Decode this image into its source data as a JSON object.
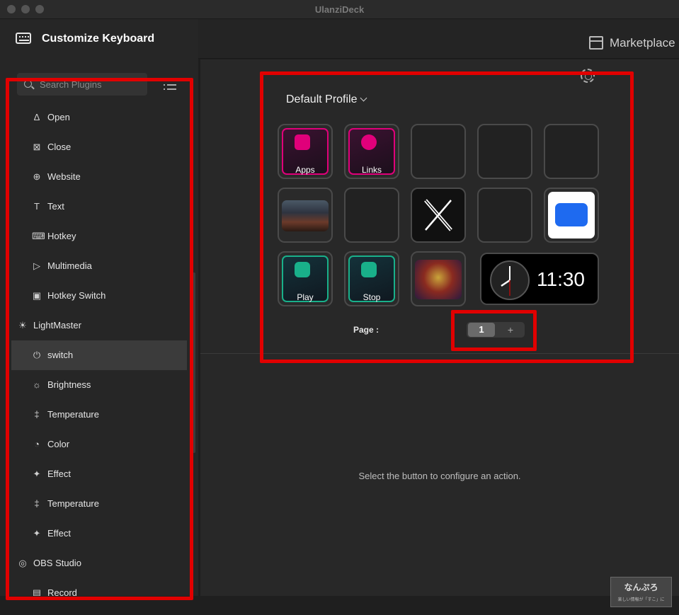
{
  "window": {
    "title": "UlanziDeck"
  },
  "sidebar": {
    "title": "Customize Keyboard",
    "search_placeholder": "Search Plugins",
    "items": [
      {
        "label": "Open",
        "icon": "rocket-icon"
      },
      {
        "label": "Close",
        "icon": "close-box-icon"
      },
      {
        "label": "Website",
        "icon": "globe-icon"
      },
      {
        "label": "Text",
        "icon": "text-icon"
      },
      {
        "label": "Hotkey",
        "icon": "keyboard-icon"
      },
      {
        "label": "Multimedia",
        "icon": "play-circle-icon"
      },
      {
        "label": "Hotkey Switch",
        "icon": "switch-box-icon"
      },
      {
        "label": "LightMaster",
        "icon": "bulb-icon"
      },
      {
        "label": "switch",
        "icon": "power-icon"
      },
      {
        "label": "Brightness",
        "icon": "sun-icon"
      },
      {
        "label": "Temperature",
        "icon": "thermometer-icon"
      },
      {
        "label": "Color",
        "icon": "palette-icon"
      },
      {
        "label": "Effect",
        "icon": "sparkle-icon"
      },
      {
        "label": "Temperature",
        "icon": "thermometer-icon"
      },
      {
        "label": "Effect",
        "icon": "sparkle-icon"
      },
      {
        "label": "OBS Studio",
        "icon": "obs-icon"
      },
      {
        "label": "Record",
        "icon": "record-icon"
      }
    ]
  },
  "topbar": {
    "marketplace": "Marketplace"
  },
  "deck": {
    "profile": "Default Profile",
    "keys": [
      {
        "label": "Apps"
      },
      {
        "label": "Links"
      },
      {
        "label": ""
      },
      {
        "label": ""
      },
      {
        "label": ""
      },
      {
        "label": ""
      },
      {
        "label": ""
      },
      {
        "label": ""
      },
      {
        "label": ""
      },
      {
        "label": ""
      },
      {
        "label": "Play"
      },
      {
        "label": "Stop"
      },
      {
        "label": ""
      }
    ],
    "clock_time": "11:30",
    "page_label": "Page :",
    "page_current": "1",
    "page_add": "+"
  },
  "detail": {
    "hint": "Select the button to configure an action."
  },
  "watermark": {
    "line1": "なんぷろ",
    "line2": "楽しい情報が「すこ」に"
  },
  "colors": {
    "accent_red": "#e10000",
    "apps_pink": "#e0007a",
    "play_teal": "#19b08a"
  }
}
